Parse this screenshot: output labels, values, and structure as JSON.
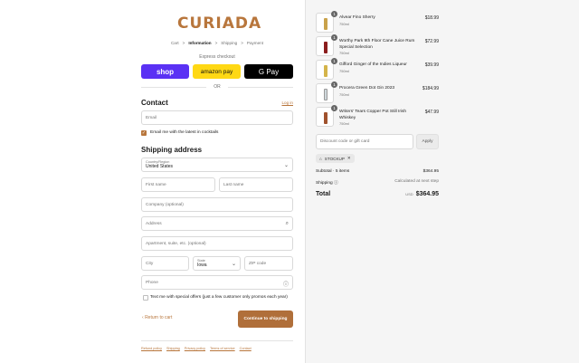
{
  "brand": {
    "logo_text": "CURIADA",
    "accent": "#b8763c"
  },
  "breadcrumbs": [
    "Cart",
    "Information",
    "Shipping",
    "Payment"
  ],
  "breadcrumb_sep": ">",
  "express": {
    "label": "Express checkout",
    "shop": "shop",
    "amazon": "amazon pay",
    "gpay": "G Pay",
    "or": "OR"
  },
  "contact": {
    "title": "Contact",
    "login": "Log in",
    "email_placeholder": "Email",
    "newsletter_label": "Email me with the latest in cocktails",
    "newsletter_checked": true
  },
  "shipping": {
    "title": "Shipping address",
    "country_label": "Country/Region",
    "country_value": "United States",
    "first_name": "First name",
    "last_name": "Last name",
    "company": "Company (optional)",
    "address": "Address",
    "apartment": "Apartment, suite, etc. (optional)",
    "city": "City",
    "state_label": "State",
    "state_value": "Iowa",
    "zip": "ZIP code",
    "phone": "Phone",
    "sms_label": "Text me with special offers (just a few customer only promos each year)",
    "sms_checked": false
  },
  "nav": {
    "back": "Return to cart",
    "continue": "Continue to shipping"
  },
  "footer": [
    "Refund policy",
    "Shipping",
    "Privacy policy",
    "Terms of service",
    "Contact"
  ],
  "order": {
    "items": [
      {
        "name": "Alvear Fino Sherry",
        "sub": "750ml",
        "price": "$18.99",
        "qty": "1",
        "color": "#c9a24a"
      },
      {
        "name": "Worthy Park 9th Floor Cane Juice Rum Special Selection",
        "sub": "750ml",
        "price": "$72.99",
        "qty": "1",
        "color": "#8b1d1d"
      },
      {
        "name": "Gifford Ginger of the Indies Liqueur",
        "sub": "750ml",
        "price": "$39.99",
        "qty": "1",
        "color": "#d4b44a"
      },
      {
        "name": "Procera Green Dot Gin 2023",
        "sub": "750ml",
        "price": "$184.99",
        "qty": "1",
        "color": "#cfd8dc"
      },
      {
        "name": "Writers' Tears Copper Pot Still Irish Whiskey",
        "sub": "750ml",
        "price": "$47.99",
        "qty": "1",
        "color": "#a0522d"
      }
    ],
    "discount_placeholder": "Discount code or gift card",
    "apply": "Apply",
    "applied_code": "STOCKUP",
    "subtotal_label": "Subtotal · 5 items",
    "subtotal": "$364.95",
    "shipping_label": "Shipping",
    "shipping_value": "Calculated at next step",
    "total_label": "Total",
    "currency": "USD",
    "total": "$364.95"
  }
}
